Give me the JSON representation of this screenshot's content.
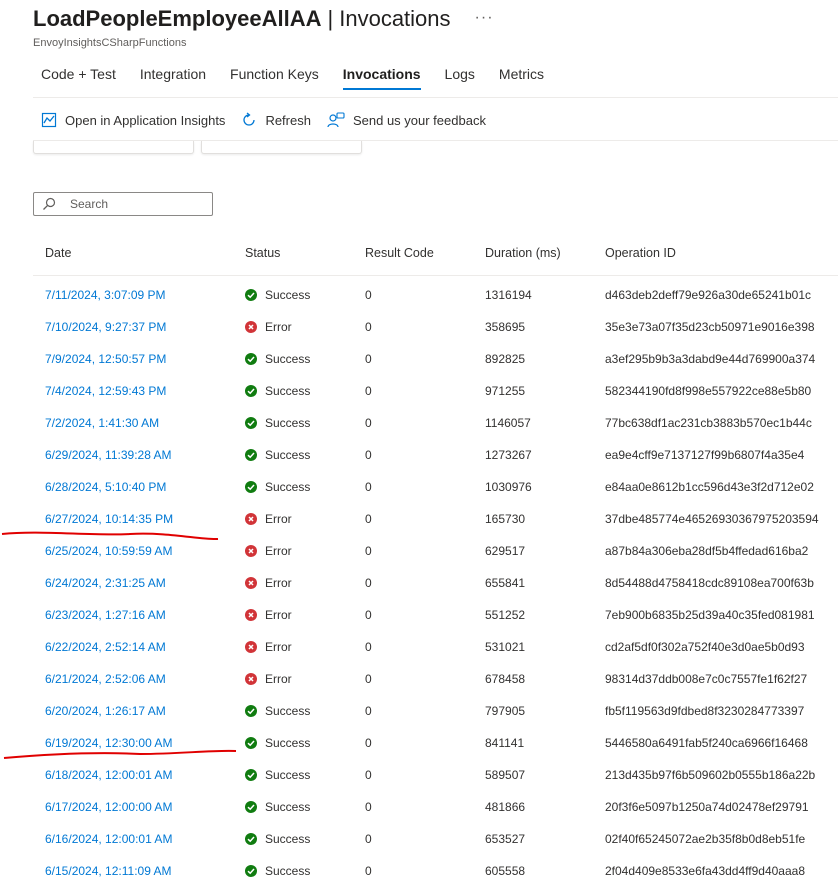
{
  "header": {
    "title": "LoadPeopleEmployeeAllAA",
    "separator": "|",
    "section": "Invocations",
    "more_label": "···",
    "subtitle": "EnvoyInsightsCSharpFunctions"
  },
  "tabs": [
    {
      "label": "Code + Test",
      "active": false
    },
    {
      "label": "Integration",
      "active": false
    },
    {
      "label": "Function Keys",
      "active": false
    },
    {
      "label": "Invocations",
      "active": true
    },
    {
      "label": "Logs",
      "active": false
    },
    {
      "label": "Metrics",
      "active": false
    }
  ],
  "toolbar": {
    "open_ai_label": "Open in Application Insights",
    "refresh_label": "Refresh",
    "feedback_label": "Send us your feedback"
  },
  "search": {
    "placeholder": "Search",
    "value": ""
  },
  "grid": {
    "columns": [
      "Date",
      "Status",
      "Result Code",
      "Duration (ms)",
      "Operation ID"
    ],
    "status_colors": {
      "Success": "#107c10",
      "Error": "#d13438"
    },
    "rows": [
      {
        "date": "7/11/2024, 3:07:09 PM",
        "status": "Success",
        "code": "0",
        "duration": "1316194",
        "op": "d463deb2deff79e926a30de65241b01c"
      },
      {
        "date": "7/10/2024, 9:27:37 PM",
        "status": "Error",
        "code": "0",
        "duration": "358695",
        "op": "35e3e73a07f35d23cb50971e9016e398"
      },
      {
        "date": "7/9/2024, 12:50:57 PM",
        "status": "Success",
        "code": "0",
        "duration": "892825",
        "op": "a3ef295b9b3a3dabd9e44d769900a374"
      },
      {
        "date": "7/4/2024, 12:59:43 PM",
        "status": "Success",
        "code": "0",
        "duration": "971255",
        "op": "582344190fd8f998e557922ce88e5b80"
      },
      {
        "date": "7/2/2024, 1:41:30 AM",
        "status": "Success",
        "code": "0",
        "duration": "1146057",
        "op": "77bc638df1ac231cb3883b570ec1b44c"
      },
      {
        "date": "6/29/2024, 11:39:28 AM",
        "status": "Success",
        "code": "0",
        "duration": "1273267",
        "op": "ea9e4cff9e7137127f99b6807f4a35e4"
      },
      {
        "date": "6/28/2024, 5:10:40 PM",
        "status": "Success",
        "code": "0",
        "duration": "1030976",
        "op": "e84aa0e8612b1cc596d43e3f2d712e02"
      },
      {
        "date": "6/27/2024, 10:14:35 PM",
        "status": "Error",
        "code": "0",
        "duration": "165730",
        "op": "37dbe485774e46526930367975203594"
      },
      {
        "date": "6/25/2024, 10:59:59 AM",
        "status": "Error",
        "code": "0",
        "duration": "629517",
        "op": "a87b84a306eba28df5b4ffedad616ba2"
      },
      {
        "date": "6/24/2024, 2:31:25 AM",
        "status": "Error",
        "code": "0",
        "duration": "655841",
        "op": "8d54488d4758418cdc89108ea700f63b"
      },
      {
        "date": "6/23/2024, 1:27:16 AM",
        "status": "Error",
        "code": "0",
        "duration": "551252",
        "op": "7eb900b6835b25d39a40c35fed081981"
      },
      {
        "date": "6/22/2024, 2:52:14 AM",
        "status": "Error",
        "code": "0",
        "duration": "531021",
        "op": "cd2af5df0f302a752f40e3d0ae5b0d93"
      },
      {
        "date": "6/21/2024, 2:52:06 AM",
        "status": "Error",
        "code": "0",
        "duration": "678458",
        "op": "98314d37ddb008e7c0c7557fe1f62f27"
      },
      {
        "date": "6/20/2024, 1:26:17 AM",
        "status": "Success",
        "code": "0",
        "duration": "797905",
        "op": "fb5f119563d9fdbed8f3230284773397"
      },
      {
        "date": "6/19/2024, 12:30:00 AM",
        "status": "Success",
        "code": "0",
        "duration": "841141",
        "op": "5446580a6491fab5f240ca6966f16468"
      },
      {
        "date": "6/18/2024, 12:00:01 AM",
        "status": "Success",
        "code": "0",
        "duration": "589507",
        "op": "213d435b97f6b509602b0555b186a22b"
      },
      {
        "date": "6/17/2024, 12:00:00 AM",
        "status": "Success",
        "code": "0",
        "duration": "481866",
        "op": "20f3f6e5097b1250a74d02478ef29791"
      },
      {
        "date": "6/16/2024, 12:00:01 AM",
        "status": "Success",
        "code": "0",
        "duration": "653527",
        "op": "02f40f65245072ae2b35f8b0d8eb51fe"
      },
      {
        "date": "6/15/2024, 12:11:09 AM",
        "status": "Success",
        "code": "0",
        "duration": "605558",
        "op": "2f04d409e8533e6fa43dd4ff9d40aaa8"
      }
    ]
  },
  "annotation_color": "#e00000"
}
